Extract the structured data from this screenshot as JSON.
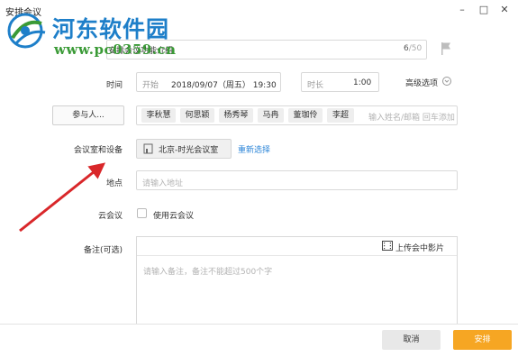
{
  "window": {
    "title": "安排会议",
    "minimize_glyph": "–",
    "maximize_glyph": "□",
    "close_glyph": "✕"
  },
  "watermark": {
    "name": "河东软件园",
    "url": "www.pc0359.cn"
  },
  "subject": {
    "label": "主题",
    "value": "安排会议功能介绍",
    "count": "6",
    "max": "/50"
  },
  "time": {
    "label": "时间",
    "start_label": "开始",
    "start_value": "2018/09/07（周五） 19:30",
    "duration_label": "时长",
    "duration_value": "1:00",
    "advanced_label": "高级选项"
  },
  "participants": {
    "button_label": "参与人...",
    "chips": [
      "李秋慧",
      "何思颖",
      "杨秀琴",
      "马冉",
      "董珈伶",
      "李超"
    ],
    "placeholder": "输入姓名/邮箱 回车添加"
  },
  "room": {
    "label": "会议室和设备",
    "value": "北京-时光会议室",
    "reselect": "重新选择"
  },
  "location": {
    "label": "地点",
    "placeholder": "请输入地址"
  },
  "cloud": {
    "label": "云会议",
    "checkbox_label": "使用云会议",
    "checked": false
  },
  "notes": {
    "label": "备注(可选)",
    "upload_label": "上传会中影片",
    "placeholder": "请输入备注，备注不能超过500个字"
  },
  "footer": {
    "cancel_label": "取消",
    "confirm_label": "安排"
  },
  "colors": {
    "accent": "#f6a623",
    "link": "#2d86d8",
    "annotation_arrow": "#d9272a",
    "watermark_blue": "#1e7fc9",
    "watermark_green": "#3a9a36"
  }
}
